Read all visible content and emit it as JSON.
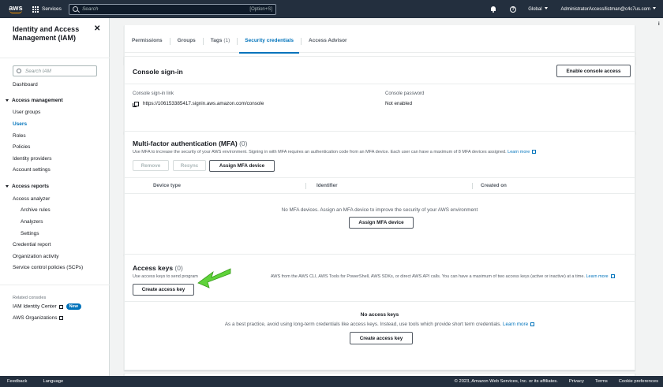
{
  "topnav": {
    "logo_text": "aws",
    "services_label": "Services",
    "search_placeholder": "Search",
    "search_shortcut": "[Option+S]",
    "region": "Global",
    "account": "AdministratorAccess/listman@c4c7us.com"
  },
  "sidebar": {
    "title": "Identity and Access Management (IAM)",
    "search_placeholder": "Search IAM",
    "dashboard": "Dashboard",
    "access_management": {
      "label": "Access management",
      "items": [
        "User groups",
        "Users",
        "Roles",
        "Policies",
        "Identity providers",
        "Account settings"
      ]
    },
    "access_reports": {
      "label": "Access reports",
      "items": [
        "Access analyzer",
        "Archive rules",
        "Analyzers",
        "Settings",
        "Credential report",
        "Organization activity",
        "Service control policies (SCPs)"
      ]
    },
    "related_consoles_label": "Related consoles",
    "related": [
      "IAM Identity Center",
      "AWS Organizations"
    ],
    "new_badge": "New"
  },
  "tabs": [
    {
      "label": "Permissions",
      "count": ""
    },
    {
      "label": "Groups",
      "count": ""
    },
    {
      "label": "Tags",
      "count": "(1)"
    },
    {
      "label": "Security credentials",
      "count": ""
    },
    {
      "label": "Access Advisor",
      "count": ""
    }
  ],
  "console_signin": {
    "title": "Console sign-in",
    "enable_button": "Enable console access",
    "link_label": "Console sign-in link",
    "link_value": "https://106153385417.signin.aws.amazon.com/console",
    "password_label": "Console password",
    "password_value": "Not enabled"
  },
  "mfa": {
    "title": "Multi-factor authentication (MFA)",
    "count": "(0)",
    "description": "Use MFA to increase the security of your AWS environment. Signing in with MFA requires an authentication code from an MFA device. Each user can have a maximum of 8 MFA devices assigned.",
    "learn_more": "Learn more",
    "remove_button": "Remove",
    "resync_button": "Resync",
    "assign_button": "Assign MFA device",
    "columns": [
      "Device type",
      "Identifier",
      "Created on"
    ],
    "empty_text": "No MFA devices. Assign an MFA device to improve the security of your AWS environment",
    "empty_button": "Assign MFA device"
  },
  "access_keys": {
    "title": "Access keys",
    "count": "(0)",
    "description_start": "Use access keys to send program",
    "description_end": "AWS from the AWS CLI, AWS Tools for PowerShell, AWS SDKs, or direct AWS API calls. You can have a maximum of two access keys (active or inactive) at a time.",
    "learn_more": "Learn more",
    "create_button": "Create access key",
    "empty_title": "No access keys",
    "empty_text": "As a best practice, avoid using long-term credentials like access keys. Instead, use tools which provide short term credentials.",
    "empty_learn_more": "Learn more",
    "empty_button": "Create access key"
  },
  "annotation": {
    "arrow_color": "#5fd33a"
  },
  "footer": {
    "feedback": "Feedback",
    "language": "Language",
    "copyright": "© 2023, Amazon Web Services, Inc. or its affiliates.",
    "privacy": "Privacy",
    "terms": "Terms",
    "cookies": "Cookie preferences"
  }
}
